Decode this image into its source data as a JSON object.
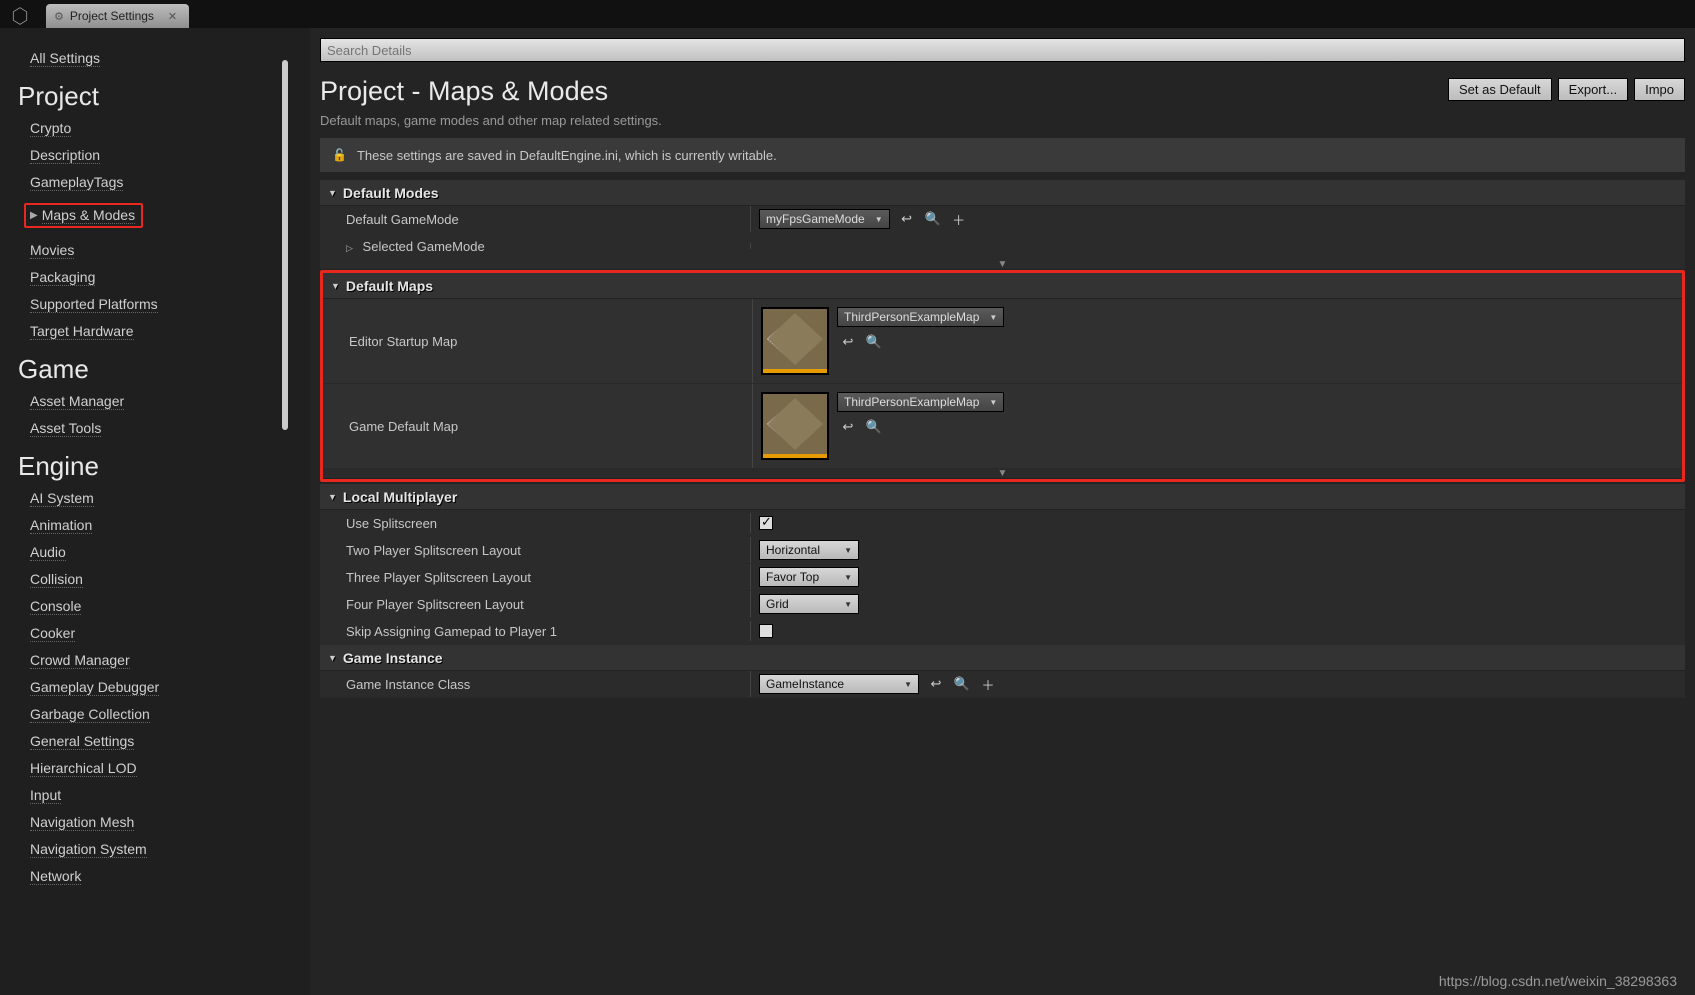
{
  "tab": {
    "title": "Project Settings"
  },
  "sidebar": {
    "all_settings": "All Settings",
    "categories": [
      {
        "title": "Project",
        "items": [
          "Crypto",
          "Description",
          "GameplayTags",
          "Maps & Modes",
          "Movies",
          "Packaging",
          "Supported Platforms",
          "Target Hardware"
        ],
        "selected_index": 3
      },
      {
        "title": "Game",
        "items": [
          "Asset Manager",
          "Asset Tools"
        ]
      },
      {
        "title": "Engine",
        "items": [
          "AI System",
          "Animation",
          "Audio",
          "Collision",
          "Console",
          "Cooker",
          "Crowd Manager",
          "Gameplay Debugger",
          "Garbage Collection",
          "General Settings",
          "Hierarchical LOD",
          "Input",
          "Navigation Mesh",
          "Navigation System",
          "Network"
        ]
      }
    ]
  },
  "header": {
    "title": "Project - Maps & Modes",
    "subtitle": "Default maps, game modes and other map related settings.",
    "buttons": {
      "set_default": "Set as Default",
      "export": "Export...",
      "import": "Impo"
    },
    "search_placeholder": "Search Details"
  },
  "info_bar": "These settings are saved in DefaultEngine.ini, which is currently writable.",
  "sections": {
    "default_modes": {
      "title": "Default Modes",
      "default_gamemode_label": "Default GameMode",
      "default_gamemode_value": "myFpsGameMode",
      "selected_gamemode_label": "Selected GameMode"
    },
    "default_maps": {
      "title": "Default Maps",
      "editor_startup_label": "Editor Startup Map",
      "editor_startup_value": "ThirdPersonExampleMap",
      "game_default_label": "Game Default Map",
      "game_default_value": "ThirdPersonExampleMap"
    },
    "local_multi": {
      "title": "Local Multiplayer",
      "use_splitscreen_label": "Use Splitscreen",
      "use_splitscreen_checked": true,
      "two_player_label": "Two Player Splitscreen Layout",
      "two_player_value": "Horizontal",
      "three_player_label": "Three Player Splitscreen Layout",
      "three_player_value": "Favor Top",
      "four_player_label": "Four Player Splitscreen Layout",
      "four_player_value": "Grid",
      "skip_gamepad_label": "Skip Assigning Gamepad to Player 1",
      "skip_gamepad_checked": false
    },
    "game_instance": {
      "title": "Game Instance",
      "class_label": "Game Instance Class",
      "class_value": "GameInstance"
    }
  },
  "watermark": "https://blog.csdn.net/weixin_38298363"
}
